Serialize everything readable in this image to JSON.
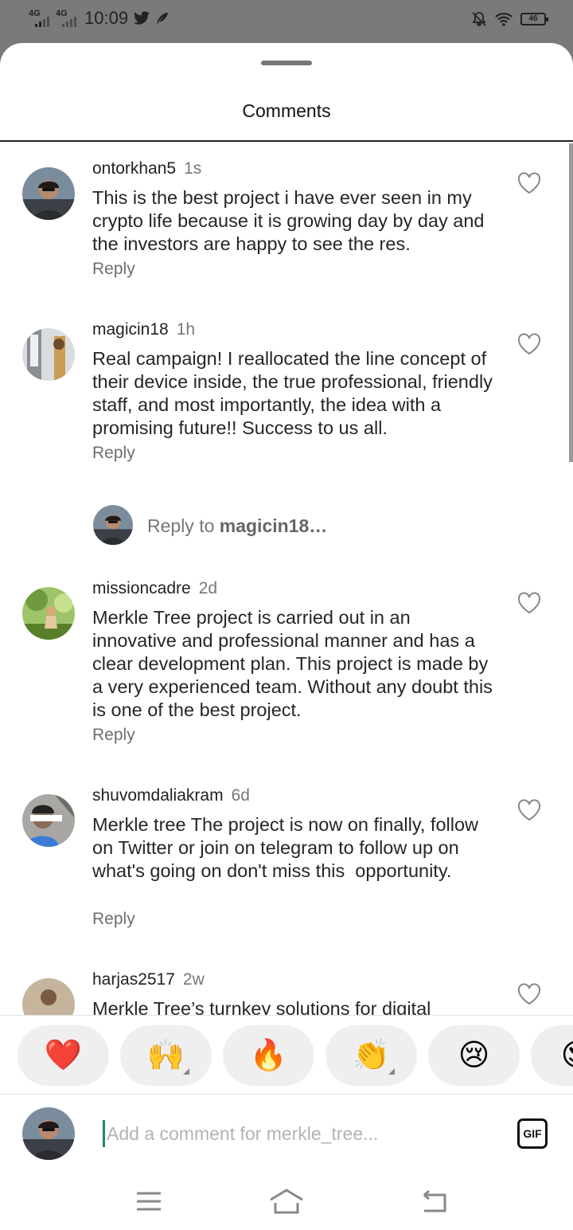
{
  "status_bar": {
    "network_1": "4G",
    "network_2": "4G",
    "time": "10:09",
    "battery": "46",
    "icons": [
      "twitter-icon",
      "feather-icon",
      "mute-icon",
      "wifi-icon",
      "battery-icon"
    ]
  },
  "sheet": {
    "title": "Comments"
  },
  "comments": [
    {
      "username": "ontorkhan5",
      "age": "1s",
      "text": "This is the best project i have ever seen in my crypto life because it is growing day by day and the investors are happy to see the res.",
      "reply_label": "Reply"
    },
    {
      "username": "magicin18",
      "age": "1h",
      "text": "Real campaign! I reallocated the line concept of their device inside, the true professional, friendly staff, and most importantly, the idea with a promising future!! Success to us all.",
      "reply_label": "Reply"
    },
    {
      "username": "missioncadre",
      "age": "2d",
      "text": "Merkle Tree project is carried out in an innovative and professional manner and has a clear development plan. This project is made by a very experienced team. Without any doubt this is one of the best project.",
      "reply_label": "Reply"
    },
    {
      "username": "shuvomdaliakram",
      "age": "6d",
      "text": "Merkle tree The project is now on finally, follow on Twitter or join on telegram to follow up on what's going on don't miss this  opportunity.",
      "reply_label": "Reply"
    },
    {
      "username": "harjas2517",
      "age": "2w",
      "text": "Merkle Tree’s turnkey solutions for digital"
    }
  ],
  "reply_prompt": {
    "prefix": "Reply to ",
    "username": "magicin18…"
  },
  "reactions": [
    "❤️",
    "🙌",
    "🔥",
    "👏",
    "😢",
    "😍"
  ],
  "composer": {
    "placeholder": "Add a comment for merkle_tree...",
    "value": "",
    "gif_label": "GIF"
  },
  "nav": [
    "menu-icon",
    "home-icon",
    "back-icon"
  ],
  "colors": {
    "accent_cursor": "#1a8a6a",
    "heart_red": "#e0242c",
    "status_bar": "#7a7a7a"
  }
}
